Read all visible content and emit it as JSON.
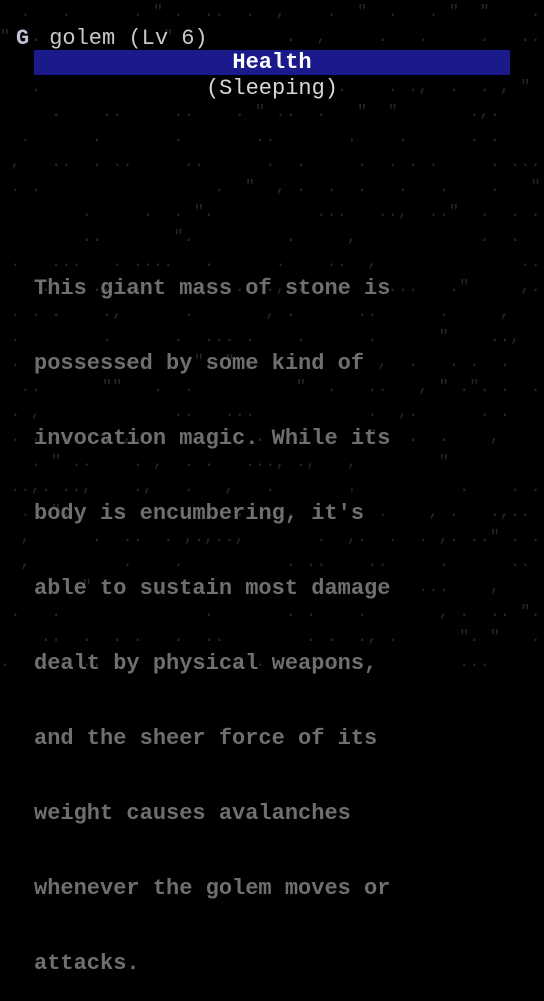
{
  "monster": {
    "glyph": "G",
    "name_level": "golem (Lv 6)",
    "status": "(Sleeping)"
  },
  "tab": {
    "active_label": "Health"
  },
  "description": [
    "This giant mass of stone is",
    "possessed by some kind of",
    "invocation magic. While its",
    "body is encumbering, it's",
    "able to sustain most damage",
    "dealt by physical weapons,",
    "and the sheer force of its",
    "weight causes avalanches",
    "whenever the golem moves or",
    "attacks."
  ],
  "colors": {
    "highlight_bar": "#1a1a8c",
    "background": "#000000",
    "description_text": "#6f6f6f"
  }
}
